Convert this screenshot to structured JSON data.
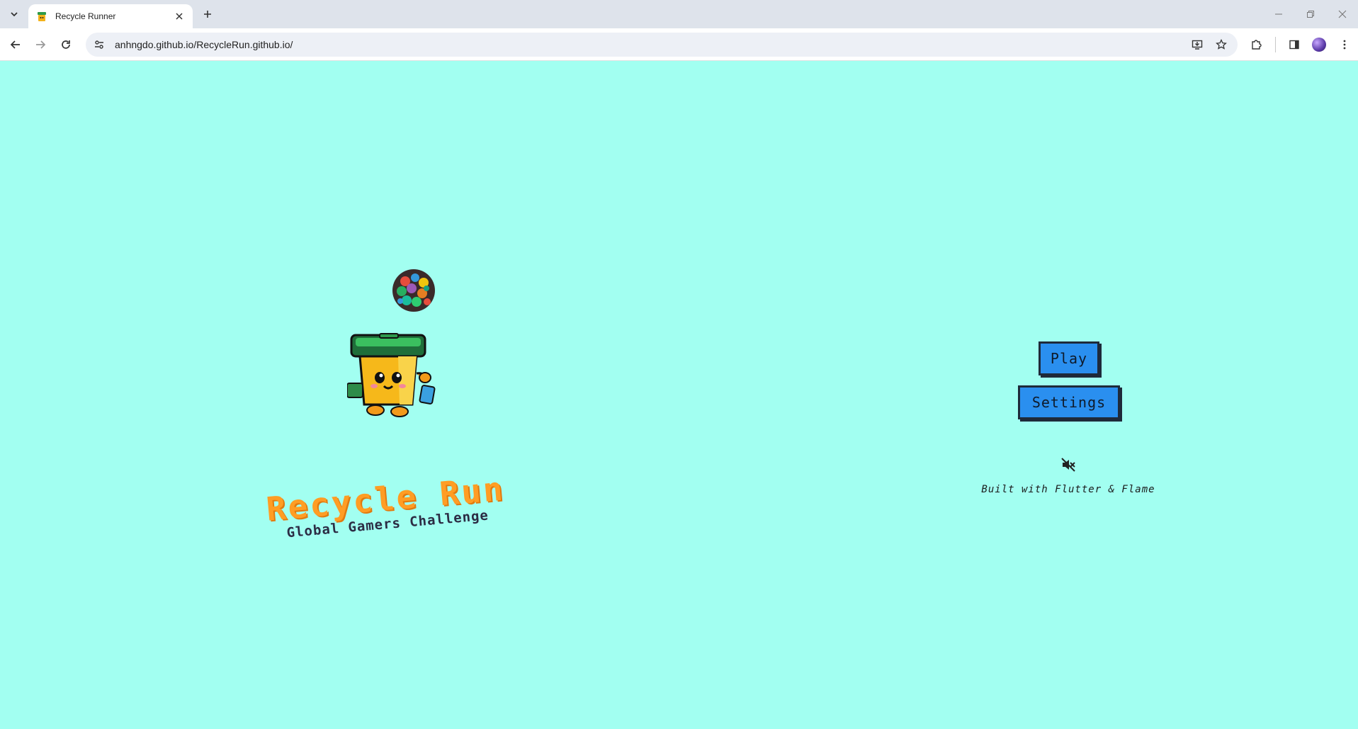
{
  "browser": {
    "tab": {
      "title": "Recycle Runner"
    },
    "url": "anhngdo.github.io/RecycleRun.github.io/"
  },
  "game": {
    "title": "Recycle Run",
    "subtitle": "Global Gamers Challenge",
    "buttons": {
      "play": "Play",
      "settings": "Settings"
    },
    "audio_icon": "speaker-muted-icon",
    "credit": "Built with Flutter & Flame"
  },
  "colors": {
    "background": "#a2fff1",
    "button": "#2a8fef",
    "title": "#ff9d24"
  }
}
